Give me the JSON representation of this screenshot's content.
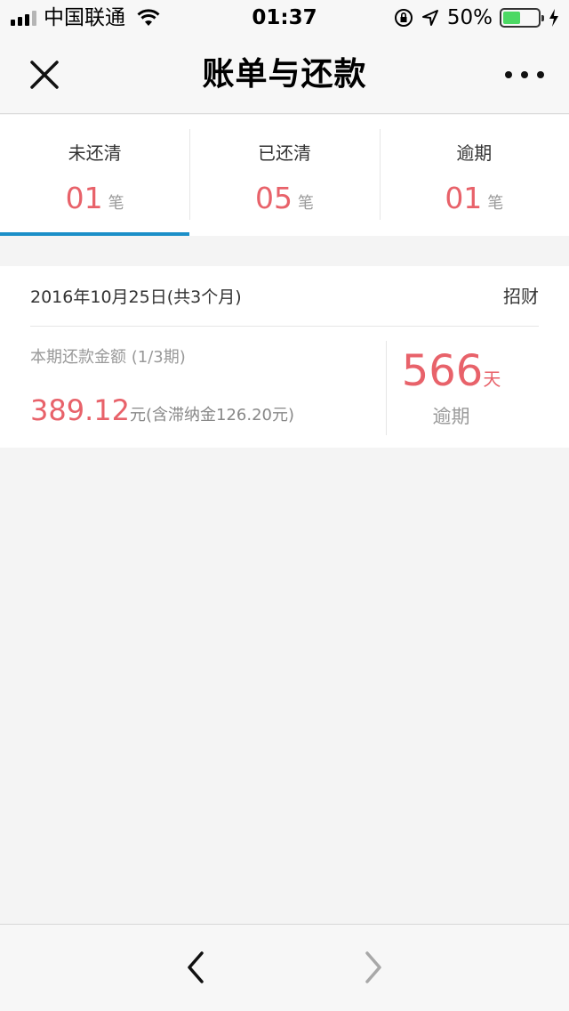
{
  "status_bar": {
    "carrier": "中国联通",
    "time": "01:37",
    "battery_percent": "50%",
    "battery_level": 0.5,
    "icons": [
      "signal-icon",
      "wifi-icon",
      "rotation-lock-icon",
      "location-icon",
      "battery-icon",
      "charging-icon"
    ]
  },
  "nav": {
    "title": "账单与还款",
    "close_icon": "close-icon",
    "more_icon": "more-icon"
  },
  "tabs": [
    {
      "label": "未还清",
      "count": "01",
      "unit": "笔",
      "active": true
    },
    {
      "label": "已还清",
      "count": "05",
      "unit": "笔",
      "active": false
    },
    {
      "label": "逾期",
      "count": "01",
      "unit": "笔",
      "active": false
    }
  ],
  "bill": {
    "date": "2016年10月25日(共3个月)",
    "bank": "招财",
    "amount_label": "本期还款金额 (1/3期)",
    "amount": "389.12",
    "amount_suffix": "元(含滞纳金126.20元)",
    "overdue_days": "566",
    "overdue_unit": "天",
    "overdue_text": "逾期"
  },
  "toolbar": {
    "back_icon": "back-arrow-icon",
    "forward_icon": "forward-arrow-icon"
  },
  "colors": {
    "accent_red": "#e8626a",
    "tab_indicator": "#1b8fc8",
    "battery_green": "#4cd964"
  }
}
